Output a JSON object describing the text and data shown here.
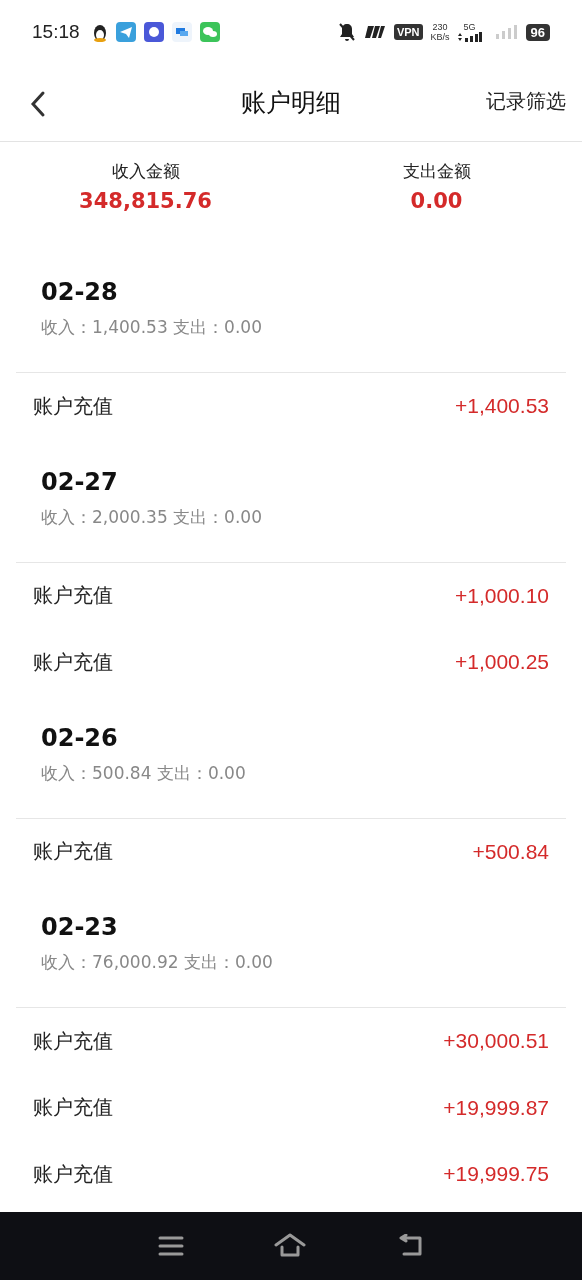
{
  "status_bar": {
    "time": "15:18",
    "vpn": "VPN",
    "speed_value": "230",
    "speed_unit": "KB/s",
    "network": "5G",
    "battery": "96"
  },
  "header": {
    "title": "账户明细",
    "action": "记录筛选"
  },
  "summary": [
    {
      "label": "收入金额",
      "amount": "348,815.76"
    },
    {
      "label": "支出金额",
      "amount": "0.00"
    }
  ],
  "groups": [
    {
      "date": "02-28",
      "totals": "收入：1,400.53 支出：0.00",
      "rows": [
        {
          "name": "账户充值",
          "amount": "+1,400.53"
        }
      ]
    },
    {
      "date": "02-27",
      "totals": "收入：2,000.35 支出：0.00",
      "rows": [
        {
          "name": "账户充值",
          "amount": "+1,000.10"
        },
        {
          "name": "账户充值",
          "amount": "+1,000.25"
        }
      ]
    },
    {
      "date": "02-26",
      "totals": "收入：500.84 支出：0.00",
      "rows": [
        {
          "name": "账户充值",
          "amount": "+500.84"
        }
      ]
    },
    {
      "date": "02-23",
      "totals": "收入：76,000.92 支出：0.00",
      "rows": [
        {
          "name": "账户充值",
          "amount": "+30,000.51"
        },
        {
          "name": "账户充值",
          "amount": "+19,999.87"
        },
        {
          "name": "账户充值",
          "amount": "+19,999.75"
        }
      ]
    }
  ]
}
